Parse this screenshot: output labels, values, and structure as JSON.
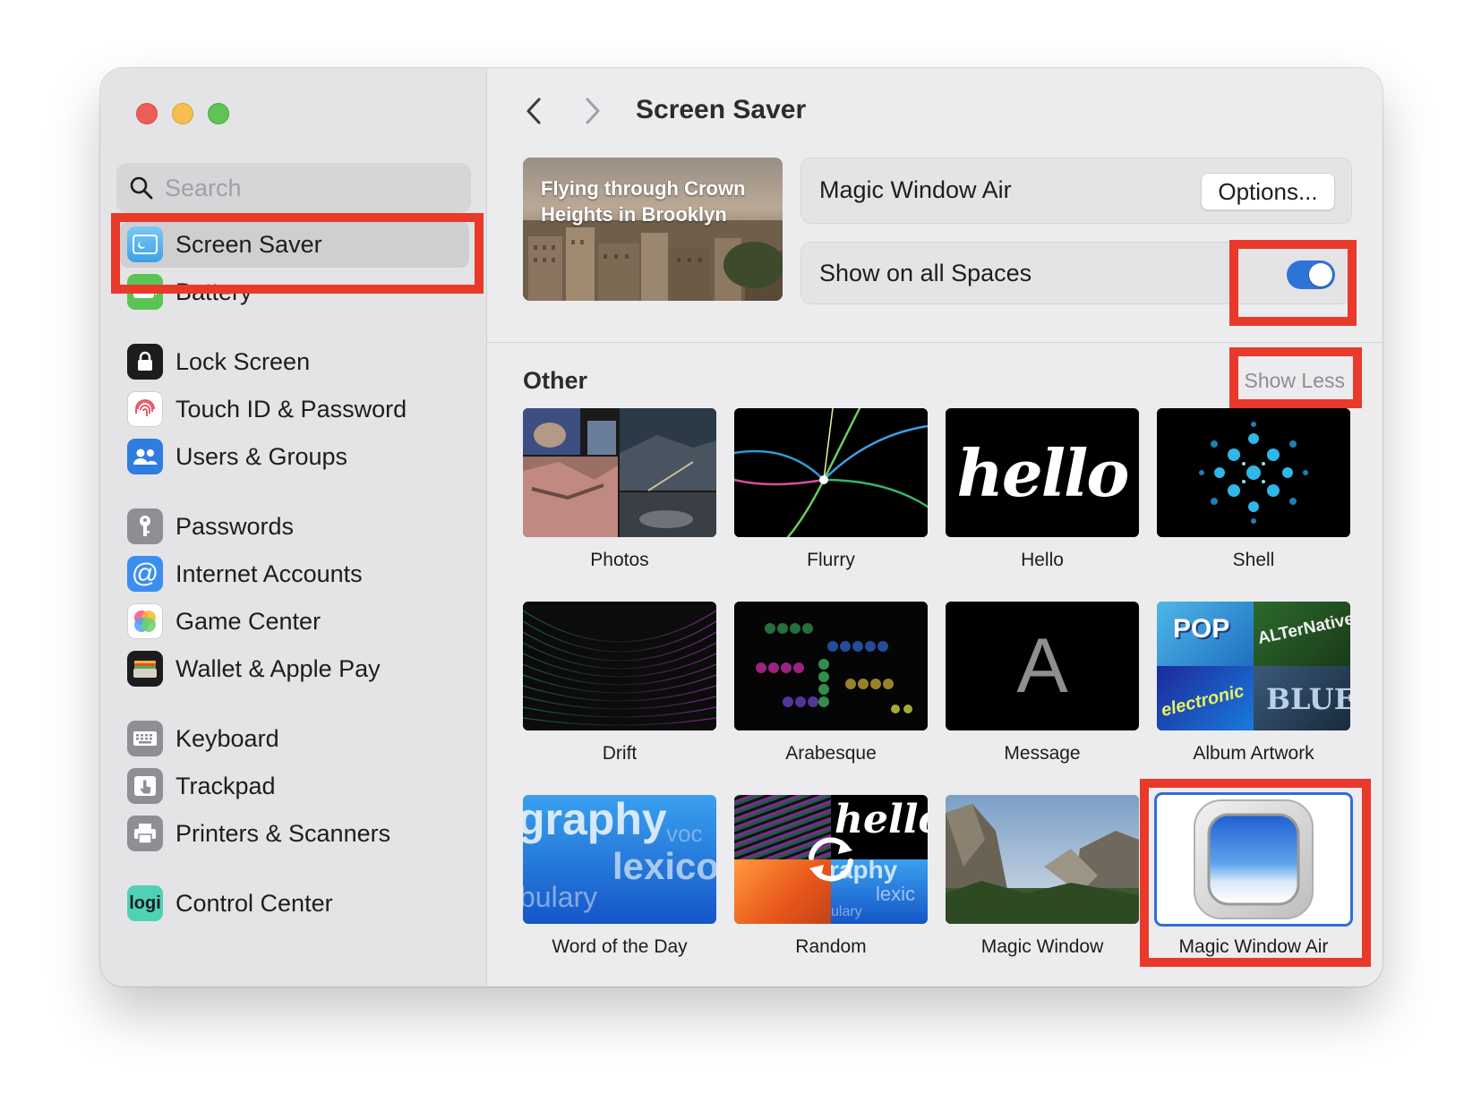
{
  "sidebar": {
    "search_placeholder": "Search",
    "items": [
      {
        "label": "Screen Saver",
        "icon": "screen-saver-icon"
      },
      {
        "label": "Battery",
        "icon": "battery-icon"
      },
      {
        "label": "Lock Screen",
        "icon": "lock-icon"
      },
      {
        "label": "Touch ID & Password",
        "icon": "fingerprint-icon"
      },
      {
        "label": "Users & Groups",
        "icon": "users-icon"
      },
      {
        "label": "Passwords",
        "icon": "key-icon"
      },
      {
        "label": "Internet Accounts",
        "icon": "at-icon"
      },
      {
        "label": "Game Center",
        "icon": "game-center-icon"
      },
      {
        "label": "Wallet & Apple Pay",
        "icon": "wallet-icon"
      },
      {
        "label": "Keyboard",
        "icon": "keyboard-icon"
      },
      {
        "label": "Trackpad",
        "icon": "trackpad-icon"
      },
      {
        "label": "Printers & Scanners",
        "icon": "printer-icon"
      },
      {
        "label": "Control Center",
        "icon": "logi-icon",
        "icon_text": "logi"
      }
    ]
  },
  "header": {
    "title": "Screen Saver"
  },
  "preview": {
    "caption": "Flying through Crown Heights in Brooklyn"
  },
  "current_saver": {
    "name": "Magic Window Air",
    "options_label": "Options..."
  },
  "show_on_all_spaces": {
    "label": "Show on all Spaces",
    "enabled": true
  },
  "other_section": {
    "title": "Other",
    "show_less_label": "Show Less",
    "savers": [
      {
        "name": "Photos"
      },
      {
        "name": "Flurry"
      },
      {
        "name": "Hello",
        "thumb_text": "hello"
      },
      {
        "name": "Shell"
      },
      {
        "name": "Drift"
      },
      {
        "name": "Arabesque"
      },
      {
        "name": "Message",
        "thumb_text": "A"
      },
      {
        "name": "Album Artwork",
        "thumb_words": [
          "POP",
          "ALTerNative",
          "electronic",
          "BLUES"
        ]
      },
      {
        "name": "Word of the Day",
        "thumb_words": [
          "graphy",
          "voc",
          "lexico",
          "bulary"
        ]
      },
      {
        "name": "Random",
        "thumb_words": [
          "hello",
          "raphy",
          "lexic",
          "ulary"
        ]
      },
      {
        "name": "Magic Window"
      },
      {
        "name": "Magic Window Air",
        "selected": true
      }
    ]
  },
  "colors": {
    "accent": "#2e73d8",
    "annotation": "#e8392b"
  }
}
